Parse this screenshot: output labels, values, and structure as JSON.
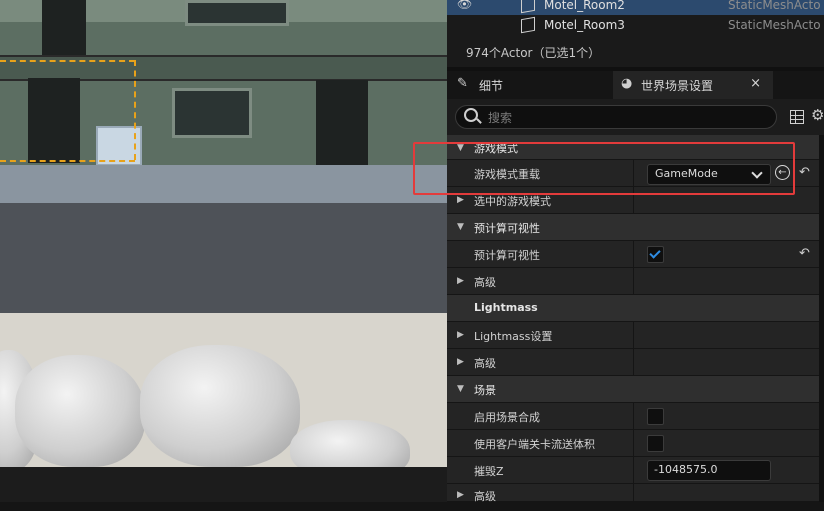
{
  "viewport": {
    "door_labels": [
      "1\n0\n2"
    ]
  },
  "outliner": {
    "rows": [
      {
        "name": "Motel_Room2",
        "type": "StaticMeshActo",
        "selected": true
      },
      {
        "name": "Motel_Room3",
        "type": "StaticMeshActo",
        "selected": false
      }
    ],
    "actor_count": "974个Actor（已选1个）"
  },
  "tabs": {
    "details_label": "细节",
    "world_label": "世界场景设置",
    "close_glyph": "×"
  },
  "search": {
    "placeholder": "搜索"
  },
  "properties": {
    "cat_game_mode": "游戏模式",
    "game_mode_override": "游戏模式重载",
    "game_mode_value": "GameMode",
    "selected_game_mode": "选中的游戏模式",
    "cat_precomputed_vis": "预计算可视性",
    "precomputed_vis": "预计算可视性",
    "advanced_1": "高级",
    "cat_lightmass": "Lightmass",
    "lightmass_settings": "Lightmass设置",
    "advanced_2": "高级",
    "cat_world": "场景",
    "enable_world_composition": "启用场景合成",
    "use_client_side_level_streaming": "使用客户端关卡流送体积",
    "kill_z": "摧毁Z",
    "kill_z_value": "-1048575.0",
    "advanced_3": "高级"
  },
  "state": {
    "precomputed_vis_checked": true,
    "enable_world_composition_checked": false,
    "client_side_streaming_checked": false
  },
  "colors": {
    "selection_blue": "#2c4a6e",
    "highlight_red": "#e33b3b",
    "checkbox_blue": "#2f8de4",
    "actor_selection_orange": "#e8a21a"
  }
}
